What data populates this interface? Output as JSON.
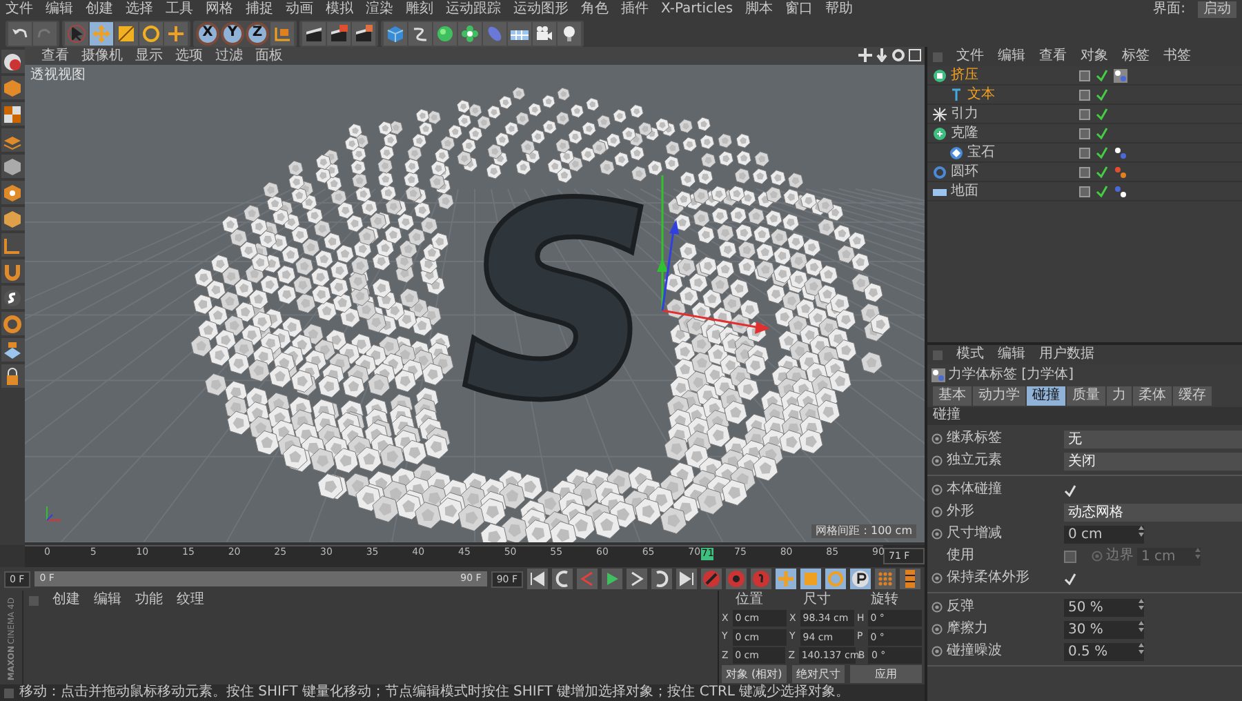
{
  "menu_bar": {
    "items": [
      "文件",
      "编辑",
      "创建",
      "选择",
      "工具",
      "网格",
      "捕捉",
      "动画",
      "模拟",
      "渲染",
      "雕刻",
      "运动跟踪",
      "运动图形",
      "角色",
      "插件",
      "X-Particles",
      "脚本",
      "窗口",
      "帮助"
    ],
    "layout_label": "界面:",
    "layout_value": "启动"
  },
  "toolbar": {
    "tools": [
      {
        "kind": "select",
        "selected": false
      },
      {
        "kind": "move",
        "selected": true
      },
      {
        "kind": "scale",
        "selected": false
      },
      {
        "kind": "rotate",
        "selected": false
      },
      {
        "kind": "recent",
        "selected": false
      }
    ],
    "axes": [
      {
        "label": "X",
        "selected": true
      },
      {
        "label": "Y",
        "selected": true
      },
      {
        "label": "Z",
        "selected": true
      }
    ]
  },
  "viewport": {
    "menu": [
      "查看",
      "摄像机",
      "显示",
      "选项",
      "过滤",
      "面板"
    ],
    "title": "透视视图",
    "grid_spacing": "网格间距 : 100 cm",
    "object_text": "S"
  },
  "object_manager": {
    "menu": [
      "文件",
      "编辑",
      "查看",
      "对象",
      "标签",
      "书签"
    ],
    "objects": [
      {
        "kind": "extrude",
        "name": "挤压",
        "selected": true,
        "enabled": true,
        "children": [
          {
            "kind": "text",
            "name": "文本",
            "selected": true,
            "enabled": true
          }
        ]
      },
      {
        "kind": "attractor",
        "name": "引力",
        "selected": false,
        "enabled": true
      },
      {
        "kind": "cloner",
        "name": "克隆",
        "selected": false,
        "enabled": true,
        "children": [
          {
            "kind": "gem",
            "name": "宝石",
            "selected": false,
            "enabled": true
          }
        ]
      },
      {
        "kind": "torus",
        "name": "圆环",
        "selected": false,
        "enabled": true
      },
      {
        "kind": "floor",
        "name": "地面",
        "selected": false,
        "enabled": true
      }
    ]
  },
  "attributes": {
    "menu": [
      "模式",
      "编辑",
      "用户数据"
    ],
    "title": "力学体标签 [力学体]",
    "tabs": [
      {
        "label": "基本",
        "selected": false
      },
      {
        "label": "动力学",
        "selected": false
      },
      {
        "label": "碰撞",
        "selected": true
      },
      {
        "label": "质量",
        "selected": false
      },
      {
        "label": "力",
        "selected": false
      },
      {
        "label": "柔体",
        "selected": false
      },
      {
        "label": "缓存",
        "selected": false
      }
    ],
    "section": "碰撞",
    "groups": [
      {
        "fields": [
          {
            "kind": "dropdown",
            "label": "继承标签",
            "value": "无"
          },
          {
            "kind": "dropdown",
            "label": "独立元素",
            "value": "关闭"
          }
        ]
      },
      {
        "fields": [
          {
            "kind": "checkbox",
            "label": "本体碰撞",
            "checked": true
          },
          {
            "kind": "dropdown",
            "label": "外形",
            "value": "动态网格"
          },
          {
            "kind": "number",
            "label": "尺寸增减",
            "value": "0 cm"
          },
          {
            "kind": "border",
            "label": "使用",
            "checked": false,
            "sub_label": "边界",
            "value": "1 cm",
            "disabled": true
          },
          {
            "kind": "checkbox",
            "label": "保持柔体外形",
            "checked": true
          }
        ]
      },
      {
        "fields": [
          {
            "kind": "number",
            "label": "反弹",
            "value": "50 %"
          },
          {
            "kind": "number",
            "label": "摩擦力",
            "value": "30 %"
          },
          {
            "kind": "number",
            "label": "碰撞噪波",
            "value": "0.5 %"
          }
        ]
      }
    ]
  },
  "timeline": {
    "ticks": [
      "0",
      "5",
      "10",
      "15",
      "20",
      "25",
      "30",
      "35",
      "40",
      "45",
      "50",
      "55",
      "60",
      "65",
      "70",
      "75",
      "80",
      "85",
      "90"
    ],
    "current_frame": "71",
    "level": 0.789,
    "frame_field": "71 F"
  },
  "transport": {
    "start_field": "0 F",
    "range_start": "0 F",
    "range_end": "90 F",
    "level": 1,
    "end_field": "90 F"
  },
  "materials": {
    "menu": [
      "创建",
      "编辑",
      "功能",
      "纹理"
    ],
    "logo_brand": "MAXON",
    "logo_product": "CINEMA 4D"
  },
  "coordinates": {
    "headers": [
      "位置",
      "尺寸",
      "旋转"
    ],
    "rows": [
      {
        "axes": [
          "X",
          "X",
          "H"
        ],
        "values": [
          "0 cm",
          "98.34 cm",
          "0 °"
        ]
      },
      {
        "axes": [
          "Y",
          "Y",
          "P"
        ],
        "values": [
          "0 cm",
          "94 cm",
          "0 °"
        ]
      },
      {
        "axes": [
          "Z",
          "Z",
          "B"
        ],
        "values": [
          "0 cm",
          "140.137 cm",
          "0 °"
        ]
      }
    ],
    "mode_dropdown": "对象 (相对)",
    "size_dropdown": "绝对尺寸",
    "apply_button": "应用"
  },
  "status_bar": "移动：点击并拖动鼠标移动元素。按住 SHIFT 键量化移动；节点编辑模式时按住 SHIFT 键增加选择对象；按住 CTRL 键减少选择对象。"
}
